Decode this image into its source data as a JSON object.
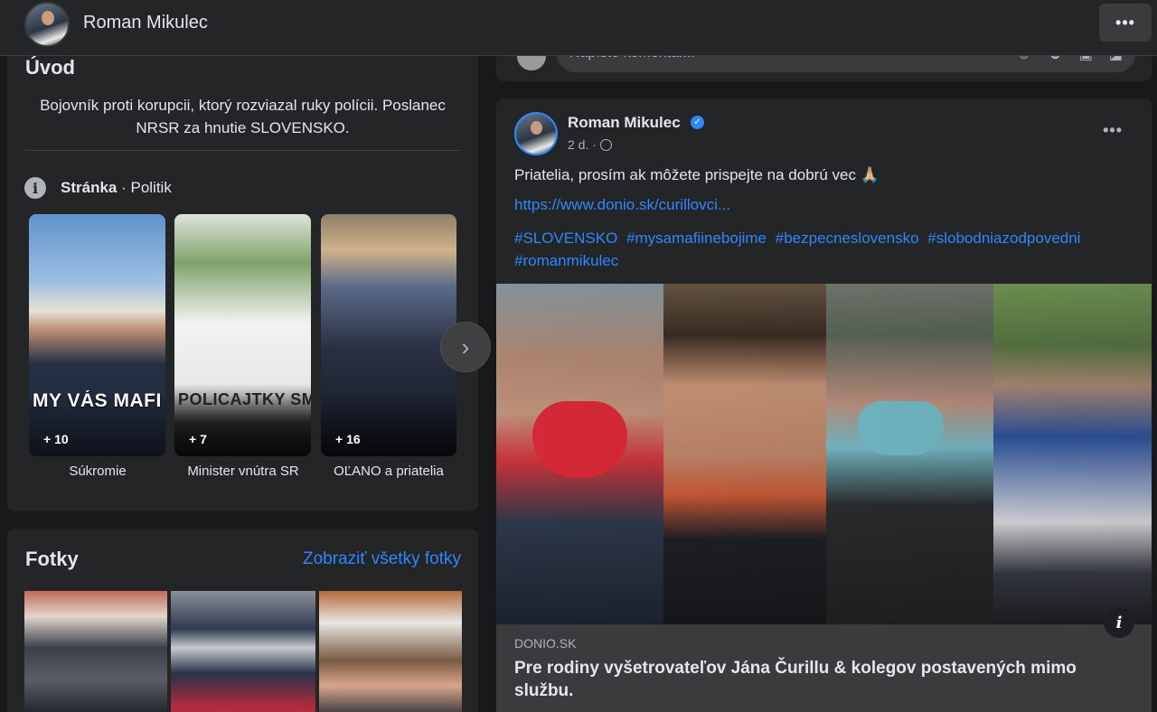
{
  "header": {
    "profile_name": "Roman Mikulec",
    "more_label": "•••"
  },
  "intro": {
    "title": "Úvod",
    "bio": "Bojovník proti korupcii, ktorý rozviazal ruky polícii. Poslanec NRSR za hnutie SLOVENSKO.",
    "page_type_bold": "Stránka",
    "page_type_rest": " · Politik",
    "highlights": [
      {
        "label": "Súkromie",
        "count": "+ 10",
        "image_text": "MY VÁS MAFI NEPREDÁME"
      },
      {
        "label": "Minister vnútra SR",
        "count": "+ 7",
        "image_text": "POLICAJTKY SME ZV"
      },
      {
        "label": "OĽANO a priatelia",
        "count": "+ 16",
        "image_text": ""
      }
    ],
    "next_arrow": "›"
  },
  "photos": {
    "title": "Fotky",
    "see_all": "Zobraziť všetky fotky"
  },
  "comment_box": {
    "placeholder": "Napíšte komentár...",
    "icons": [
      "sticker-icon",
      "emoji-icon",
      "camera-icon",
      "gif-icon"
    ]
  },
  "post": {
    "author": "Roman Mikulec",
    "verified": true,
    "time": "2 d. ·",
    "text": "Priatelia, prosím ak môžete prispejte na dobrú vec 🙏🏼",
    "link": "https://www.donio.sk/curillovci...",
    "hashtags": [
      "#SLOVENSKO",
      "#mysamafiinebojime",
      "#bezpecneslovensko",
      "#slobodniazodpovedni",
      "#romanmikulec"
    ],
    "more_label": "•••",
    "preview": {
      "domain": "DONIO.SK",
      "title": "Pre rodiny vyšetrovateľov Jána Čurillu & kolegov postavených mimo službu."
    }
  }
}
